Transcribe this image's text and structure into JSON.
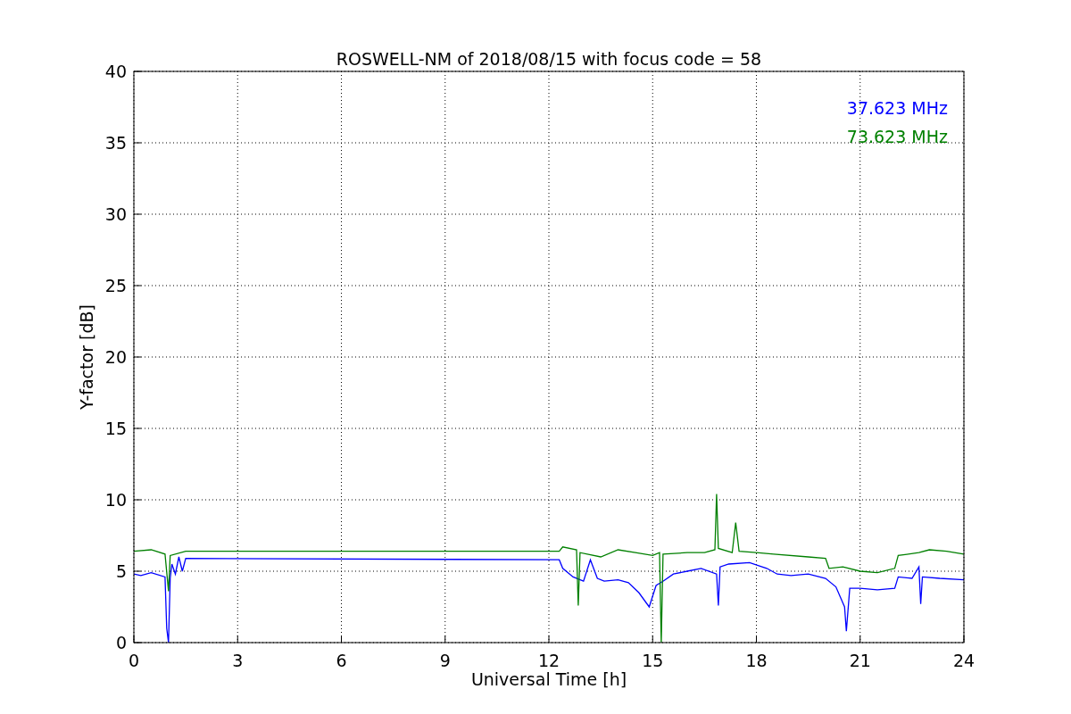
{
  "chart_data": {
    "type": "line",
    "title": "ROSWELL-NM of 2018/08/15 with focus code = 58",
    "xlabel": "Universal Time [h]",
    "ylabel": "Y-factor [dB]",
    "xlim": [
      0,
      24
    ],
    "ylim": [
      0,
      40
    ],
    "xticks": [
      0,
      3,
      6,
      9,
      12,
      15,
      18,
      21,
      24
    ],
    "yticks": [
      0,
      5,
      10,
      15,
      20,
      25,
      30,
      35,
      40
    ],
    "grid": true,
    "series": [
      {
        "name": "37.623 MHz",
        "color": "#0000ff",
        "x": [
          0,
          0.2,
          0.5,
          0.9,
          0.95,
          1.0,
          1.05,
          1.1,
          1.2,
          1.3,
          1.4,
          1.5,
          12.3,
          12.4,
          12.7,
          13,
          13.2,
          13.4,
          13.6,
          14,
          14.3,
          14.6,
          14.9,
          15.1,
          15.3,
          15.6,
          16,
          16.4,
          16.85,
          16.9,
          16.95,
          17.2,
          17.8,
          18.3,
          18.6,
          19,
          19.5,
          20,
          20.3,
          20.55,
          20.6,
          20.7,
          21,
          21.5,
          22,
          22.1,
          22.5,
          22.7,
          22.75,
          22.8,
          23.3,
          24
        ],
        "values": [
          4.8,
          4.7,
          4.9,
          4.6,
          1,
          0,
          4.5,
          5.5,
          4.8,
          6,
          5,
          5.9,
          5.8,
          5.2,
          4.6,
          4.3,
          5.8,
          4.5,
          4.3,
          4.4,
          4.2,
          3.5,
          2.5,
          4.0,
          4.3,
          4.8,
          5.0,
          5.2,
          4.8,
          2.6,
          5.3,
          5.5,
          5.6,
          5.2,
          4.8,
          4.7,
          4.8,
          4.5,
          3.9,
          2.5,
          0.8,
          3.8,
          3.8,
          3.7,
          3.8,
          4.6,
          4.5,
          5.3,
          2.7,
          4.6,
          4.5,
          4.4
        ]
      },
      {
        "name": "73.623 MHz",
        "color": "#008000",
        "x": [
          0,
          0.5,
          0.9,
          1.0,
          1.05,
          1.5,
          12.3,
          12.4,
          12.8,
          12.85,
          12.9,
          13.5,
          14,
          14.5,
          15,
          15.2,
          15.25,
          15.3,
          16,
          16.5,
          16.8,
          16.85,
          16.9,
          17.3,
          17.4,
          17.5,
          18,
          18.5,
          19.5,
          20,
          20.1,
          20.5,
          21,
          21.5,
          22,
          22.1,
          22.7,
          23,
          23.5,
          24
        ],
        "values": [
          6.4,
          6.5,
          6.2,
          3.6,
          6.1,
          6.4,
          6.4,
          6.7,
          6.5,
          2.6,
          6.3,
          6.0,
          6.5,
          6.3,
          6.1,
          6.3,
          0,
          6.2,
          6.3,
          6.3,
          6.5,
          10.4,
          6.6,
          6.3,
          8.4,
          6.4,
          6.3,
          6.2,
          6.0,
          5.9,
          5.2,
          5.3,
          5.0,
          4.9,
          5.2,
          6.1,
          6.3,
          6.5,
          6.4,
          6.2
        ]
      }
    ]
  }
}
